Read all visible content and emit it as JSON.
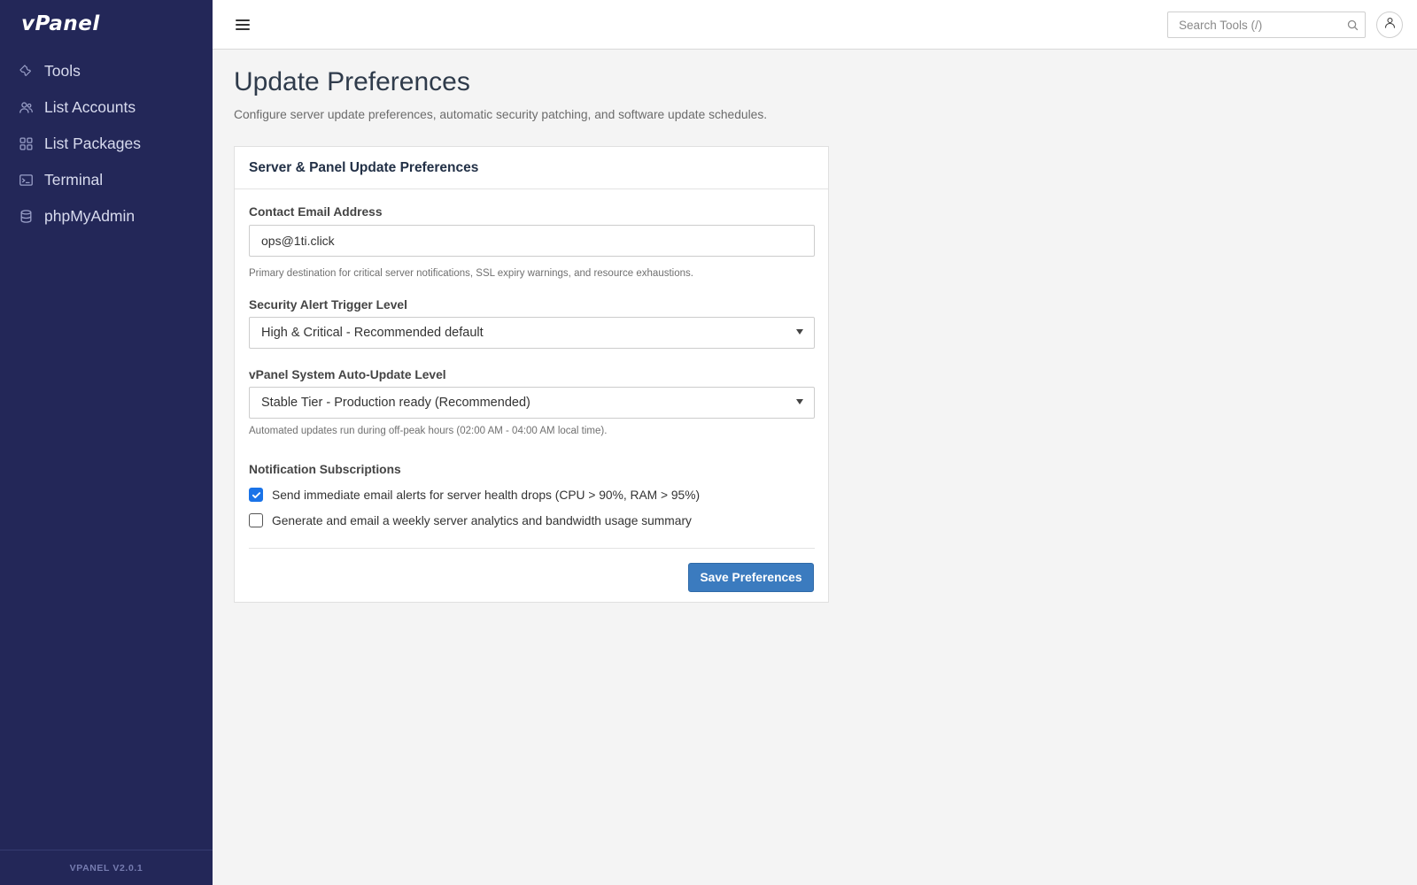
{
  "app": {
    "logo": "vPanel",
    "version": "VPANEL V2.0.1"
  },
  "sidebar": {
    "items": [
      {
        "label": "Tools",
        "icon": "wrench-icon"
      },
      {
        "label": "List Accounts",
        "icon": "users-icon"
      },
      {
        "label": "List Packages",
        "icon": "grid-icon"
      },
      {
        "label": "Terminal",
        "icon": "terminal-icon"
      },
      {
        "label": "phpMyAdmin",
        "icon": "database-icon"
      }
    ]
  },
  "topbar": {
    "search_placeholder": "Search Tools (/)",
    "menu_icon": "hamburger-icon",
    "search_icon": "search-icon",
    "user_icon": "user-icon"
  },
  "page": {
    "title": "Update Preferences",
    "description": "Configure server update preferences, automatic security patching, and software update schedules."
  },
  "card": {
    "title": "Server & Panel Update Preferences",
    "email": {
      "label": "Contact Email Address",
      "value": "ops@1ti.click",
      "help": "Primary destination for critical server notifications, SSL expiry warnings, and resource exhaustions."
    },
    "security_level": {
      "label": "Security Alert Trigger Level",
      "value": "High & Critical - Recommended default"
    },
    "auto_update": {
      "label": "vPanel System Auto-Update Level",
      "value": "Stable Tier - Production ready (Recommended)",
      "help": "Automated updates run during off-peak hours (02:00 AM - 04:00 AM local time)."
    },
    "notifications": {
      "label": "Notification Subscriptions",
      "options": [
        {
          "label": "Send immediate email alerts for server health drops (CPU > 90%, RAM > 95%)",
          "checked": true
        },
        {
          "label": "Generate and email a weekly server analytics and bandwidth usage summary",
          "checked": false
        }
      ]
    },
    "save_label": "Save Preferences"
  },
  "colors": {
    "sidebar_bg": "#232758",
    "accent": "#3b7bbf",
    "checkbox_checked": "#1a73e8",
    "page_bg": "#f4f4f4"
  }
}
